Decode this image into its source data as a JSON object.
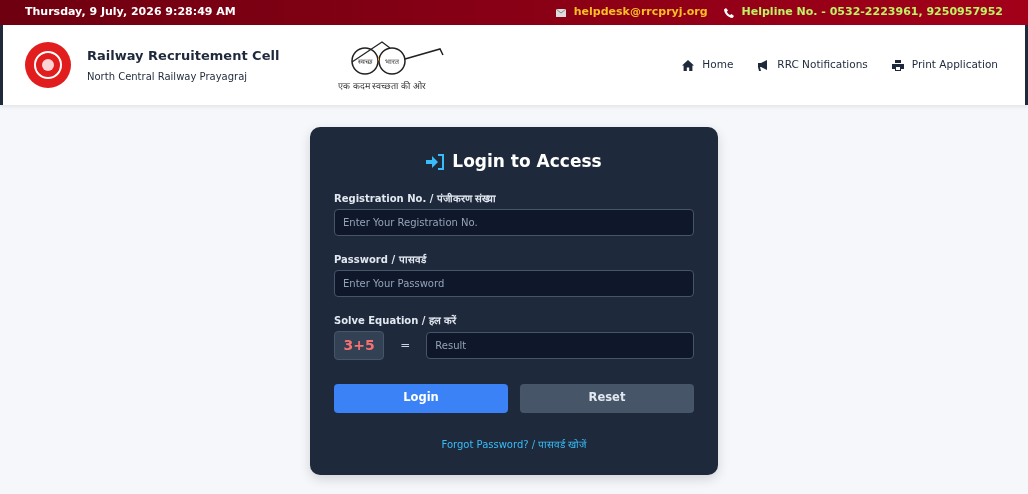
{
  "top_bar": {
    "datetime": "Thursday, 9 July, 2026 9:28:49 AM",
    "email": "helpdesk@rrcpryj.org",
    "helpline": "Helpline No. - 0532-2223961, 9250957952"
  },
  "header": {
    "title": "Railway Recruitement Cell",
    "subtitle": "North Central Railway Prayagraj",
    "campaign_logo": {
      "left_lens": "स्वच्छ",
      "right_lens": "भारत",
      "tagline": "एक कदम स्वच्छता की ओर"
    },
    "nav": [
      {
        "kind": "home",
        "label": "Home"
      },
      {
        "kind": "notifications",
        "label": "RRC Notifications"
      },
      {
        "kind": "print",
        "label": "Print Application"
      }
    ]
  },
  "login": {
    "title": "Login to Access",
    "fields": [
      {
        "label": "Registration No. / पंजीकरण संख्या",
        "placeholder": "Enter Your Registration No."
      },
      {
        "label": "Password / पासवर्ड",
        "placeholder": "Enter Your Password"
      }
    ],
    "captcha": {
      "label": "Solve Equation / हल करें",
      "equation": "3+5",
      "equals": "=",
      "placeholder": "Result"
    },
    "buttons": [
      {
        "kind": "primary",
        "label": "Login"
      },
      {
        "kind": "secondary",
        "label": "Reset"
      }
    ],
    "forgot_link": "Forgot Password? / पासवर्ड खोजें"
  }
}
